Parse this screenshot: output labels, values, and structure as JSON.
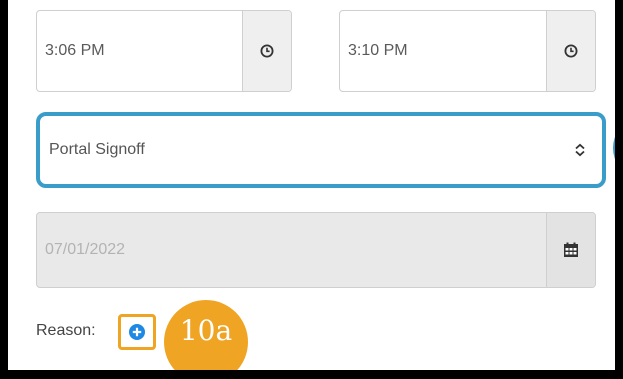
{
  "start_time": {
    "value": "3:06 PM",
    "icon": "clock-icon"
  },
  "end_time": {
    "value": "3:10 PM",
    "icon": "clock-icon"
  },
  "type_select": {
    "selected": "Portal Signoff",
    "icon": "chevron-updown-icon",
    "highlight_color": "#3a9dc9"
  },
  "date_field": {
    "value": "07/01/2022",
    "icon": "calendar-icon",
    "disabled": true
  },
  "reason": {
    "label": "Reason:",
    "add_icon": "plus-circle-icon"
  },
  "callout": {
    "label": "10a",
    "color": "#f0a423"
  }
}
